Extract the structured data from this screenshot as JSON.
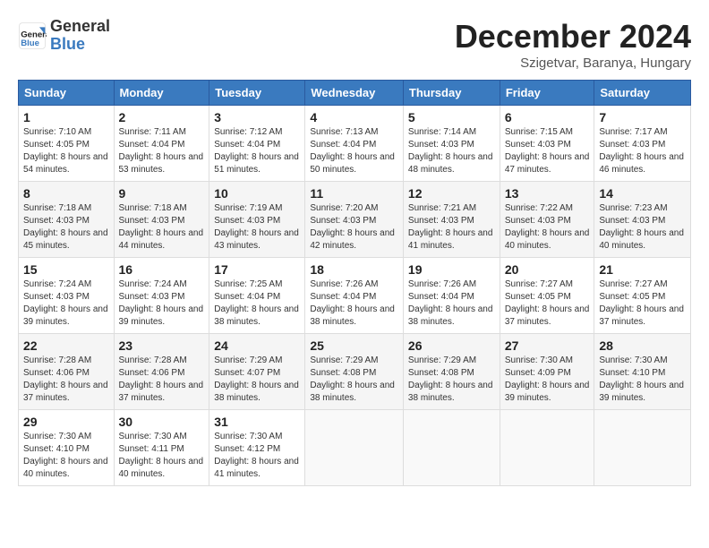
{
  "header": {
    "logo_line1": "General",
    "logo_line2": "Blue",
    "month": "December 2024",
    "location": "Szigetvar, Baranya, Hungary"
  },
  "weekdays": [
    "Sunday",
    "Monday",
    "Tuesday",
    "Wednesday",
    "Thursday",
    "Friday",
    "Saturday"
  ],
  "weeks": [
    [
      {
        "day": "1",
        "sunrise": "Sunrise: 7:10 AM",
        "sunset": "Sunset: 4:05 PM",
        "daylight": "Daylight: 8 hours and 54 minutes."
      },
      {
        "day": "2",
        "sunrise": "Sunrise: 7:11 AM",
        "sunset": "Sunset: 4:04 PM",
        "daylight": "Daylight: 8 hours and 53 minutes."
      },
      {
        "day": "3",
        "sunrise": "Sunrise: 7:12 AM",
        "sunset": "Sunset: 4:04 PM",
        "daylight": "Daylight: 8 hours and 51 minutes."
      },
      {
        "day": "4",
        "sunrise": "Sunrise: 7:13 AM",
        "sunset": "Sunset: 4:04 PM",
        "daylight": "Daylight: 8 hours and 50 minutes."
      },
      {
        "day": "5",
        "sunrise": "Sunrise: 7:14 AM",
        "sunset": "Sunset: 4:03 PM",
        "daylight": "Daylight: 8 hours and 48 minutes."
      },
      {
        "day": "6",
        "sunrise": "Sunrise: 7:15 AM",
        "sunset": "Sunset: 4:03 PM",
        "daylight": "Daylight: 8 hours and 47 minutes."
      },
      {
        "day": "7",
        "sunrise": "Sunrise: 7:17 AM",
        "sunset": "Sunset: 4:03 PM",
        "daylight": "Daylight: 8 hours and 46 minutes."
      }
    ],
    [
      {
        "day": "8",
        "sunrise": "Sunrise: 7:18 AM",
        "sunset": "Sunset: 4:03 PM",
        "daylight": "Daylight: 8 hours and 45 minutes."
      },
      {
        "day": "9",
        "sunrise": "Sunrise: 7:18 AM",
        "sunset": "Sunset: 4:03 PM",
        "daylight": "Daylight: 8 hours and 44 minutes."
      },
      {
        "day": "10",
        "sunrise": "Sunrise: 7:19 AM",
        "sunset": "Sunset: 4:03 PM",
        "daylight": "Daylight: 8 hours and 43 minutes."
      },
      {
        "day": "11",
        "sunrise": "Sunrise: 7:20 AM",
        "sunset": "Sunset: 4:03 PM",
        "daylight": "Daylight: 8 hours and 42 minutes."
      },
      {
        "day": "12",
        "sunrise": "Sunrise: 7:21 AM",
        "sunset": "Sunset: 4:03 PM",
        "daylight": "Daylight: 8 hours and 41 minutes."
      },
      {
        "day": "13",
        "sunrise": "Sunrise: 7:22 AM",
        "sunset": "Sunset: 4:03 PM",
        "daylight": "Daylight: 8 hours and 40 minutes."
      },
      {
        "day": "14",
        "sunrise": "Sunrise: 7:23 AM",
        "sunset": "Sunset: 4:03 PM",
        "daylight": "Daylight: 8 hours and 40 minutes."
      }
    ],
    [
      {
        "day": "15",
        "sunrise": "Sunrise: 7:24 AM",
        "sunset": "Sunset: 4:03 PM",
        "daylight": "Daylight: 8 hours and 39 minutes."
      },
      {
        "day": "16",
        "sunrise": "Sunrise: 7:24 AM",
        "sunset": "Sunset: 4:03 PM",
        "daylight": "Daylight: 8 hours and 39 minutes."
      },
      {
        "day": "17",
        "sunrise": "Sunrise: 7:25 AM",
        "sunset": "Sunset: 4:04 PM",
        "daylight": "Daylight: 8 hours and 38 minutes."
      },
      {
        "day": "18",
        "sunrise": "Sunrise: 7:26 AM",
        "sunset": "Sunset: 4:04 PM",
        "daylight": "Daylight: 8 hours and 38 minutes."
      },
      {
        "day": "19",
        "sunrise": "Sunrise: 7:26 AM",
        "sunset": "Sunset: 4:04 PM",
        "daylight": "Daylight: 8 hours and 38 minutes."
      },
      {
        "day": "20",
        "sunrise": "Sunrise: 7:27 AM",
        "sunset": "Sunset: 4:05 PM",
        "daylight": "Daylight: 8 hours and 37 minutes."
      },
      {
        "day": "21",
        "sunrise": "Sunrise: 7:27 AM",
        "sunset": "Sunset: 4:05 PM",
        "daylight": "Daylight: 8 hours and 37 minutes."
      }
    ],
    [
      {
        "day": "22",
        "sunrise": "Sunrise: 7:28 AM",
        "sunset": "Sunset: 4:06 PM",
        "daylight": "Daylight: 8 hours and 37 minutes."
      },
      {
        "day": "23",
        "sunrise": "Sunrise: 7:28 AM",
        "sunset": "Sunset: 4:06 PM",
        "daylight": "Daylight: 8 hours and 37 minutes."
      },
      {
        "day": "24",
        "sunrise": "Sunrise: 7:29 AM",
        "sunset": "Sunset: 4:07 PM",
        "daylight": "Daylight: 8 hours and 38 minutes."
      },
      {
        "day": "25",
        "sunrise": "Sunrise: 7:29 AM",
        "sunset": "Sunset: 4:08 PM",
        "daylight": "Daylight: 8 hours and 38 minutes."
      },
      {
        "day": "26",
        "sunrise": "Sunrise: 7:29 AM",
        "sunset": "Sunset: 4:08 PM",
        "daylight": "Daylight: 8 hours and 38 minutes."
      },
      {
        "day": "27",
        "sunrise": "Sunrise: 7:30 AM",
        "sunset": "Sunset: 4:09 PM",
        "daylight": "Daylight: 8 hours and 39 minutes."
      },
      {
        "day": "28",
        "sunrise": "Sunrise: 7:30 AM",
        "sunset": "Sunset: 4:10 PM",
        "daylight": "Daylight: 8 hours and 39 minutes."
      }
    ],
    [
      {
        "day": "29",
        "sunrise": "Sunrise: 7:30 AM",
        "sunset": "Sunset: 4:10 PM",
        "daylight": "Daylight: 8 hours and 40 minutes."
      },
      {
        "day": "30",
        "sunrise": "Sunrise: 7:30 AM",
        "sunset": "Sunset: 4:11 PM",
        "daylight": "Daylight: 8 hours and 40 minutes."
      },
      {
        "day": "31",
        "sunrise": "Sunrise: 7:30 AM",
        "sunset": "Sunset: 4:12 PM",
        "daylight": "Daylight: 8 hours and 41 minutes."
      },
      null,
      null,
      null,
      null
    ]
  ]
}
